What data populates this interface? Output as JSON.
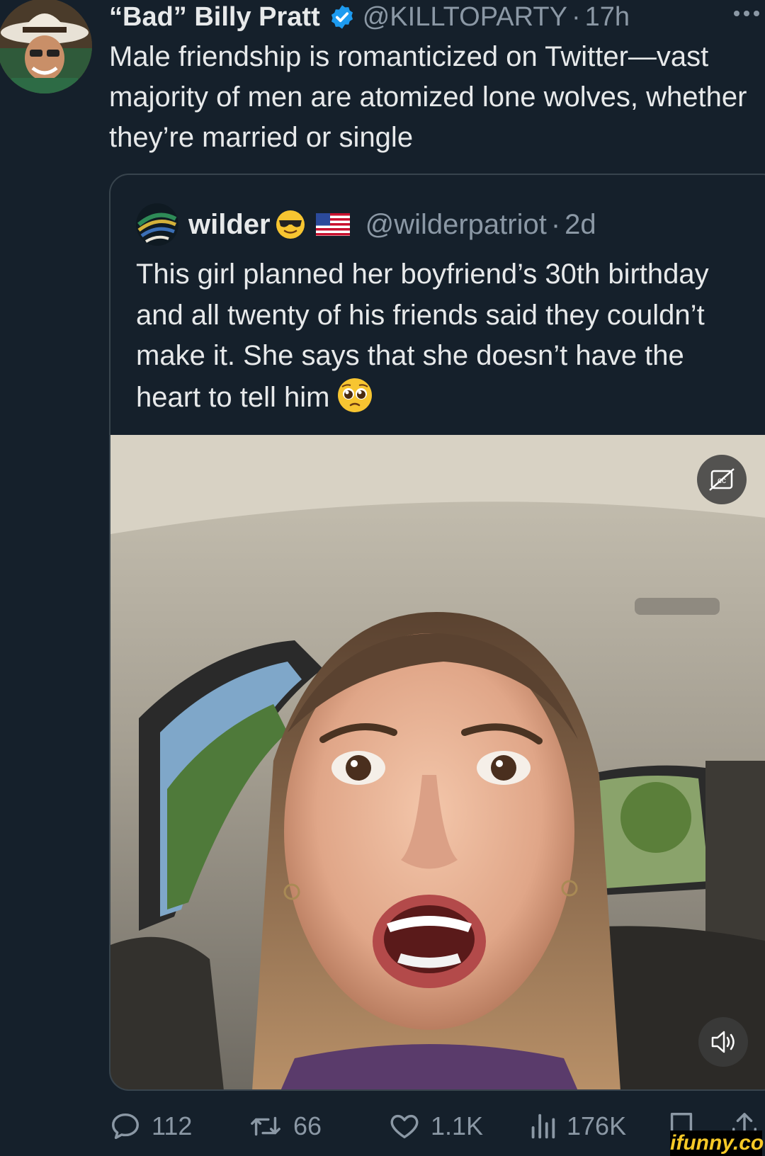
{
  "tweet": {
    "author": {
      "display_name": "“Bad” Billy Pratt",
      "handle": "@KILLTOPARTY",
      "separator": "·",
      "time": "17h"
    },
    "text": "Male friendship is romanticized on Twitter—vast majority of men are atomized lone wolves, whether they’re married or single",
    "quoted_tweet": {
      "display_name": "wilder",
      "handle": "@wilderpatriot",
      "separator": "·",
      "time": "2d",
      "text": "This girl planned her boyfriend’s 30th birthday and all twenty of his friends said they couldn’t make it. She says that she doesn’t have the heart to tell him"
    },
    "actions": {
      "replies": "112",
      "retweets": "66",
      "likes": "1.1K",
      "views": "176K"
    }
  },
  "watermark": "ifunny.co",
  "colors": {
    "background": "#15202b",
    "text": "#e7e9ea",
    "secondary_text": "#8b98a5",
    "verified_blue": "#1d9bf0",
    "border": "#38444d"
  }
}
